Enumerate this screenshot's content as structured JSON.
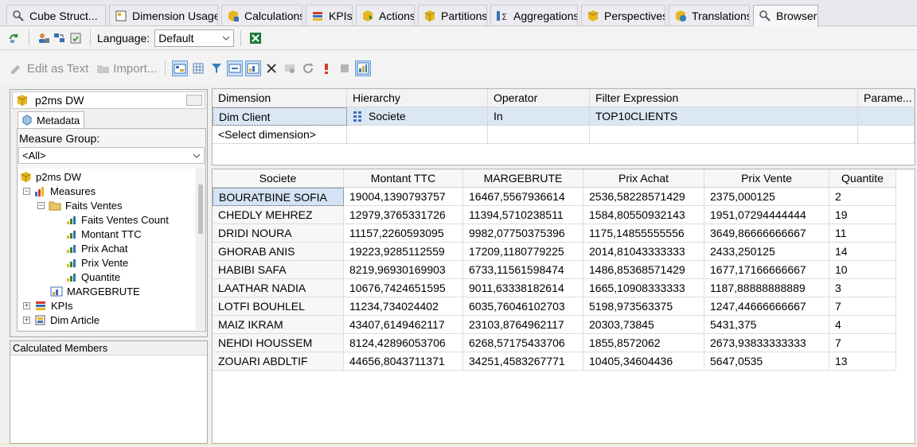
{
  "tabs": [
    {
      "label": "Cube Struct...",
      "icon": "cube-structure-icon"
    },
    {
      "label": "Dimension Usage",
      "icon": "dimension-usage-icon"
    },
    {
      "label": "Calculations",
      "icon": "calculations-icon"
    },
    {
      "label": "KPIs",
      "icon": "kpis-icon"
    },
    {
      "label": "Actions",
      "icon": "actions-icon"
    },
    {
      "label": "Partitions",
      "icon": "partitions-icon"
    },
    {
      "label": "Aggregations",
      "icon": "aggregations-icon"
    },
    {
      "label": "Perspectives",
      "icon": "perspectives-icon"
    },
    {
      "label": "Translations",
      "icon": "translations-icon"
    },
    {
      "label": "Browser",
      "icon": "browser-icon",
      "active": true
    }
  ],
  "toolbar1": {
    "language_label": "Language:",
    "language_value": "Default"
  },
  "toolbar2": {
    "edit_as_text": "Edit as Text",
    "import": "Import..."
  },
  "cube": {
    "name": "p2ms DW",
    "metadata_tab": "Metadata",
    "measure_group_label": "Measure Group:",
    "measure_group_value": "<All>"
  },
  "tree": [
    {
      "label": "p2ms DW",
      "icon": "cube-icon"
    },
    {
      "label": "Measures",
      "icon": "measures-icon",
      "expander": "−"
    },
    {
      "label": "Faits Ventes",
      "icon": "folder-icon",
      "expander": "−"
    },
    {
      "label": "Faits Ventes Count",
      "icon": "measure-icon"
    },
    {
      "label": "Montant TTC",
      "icon": "measure-icon"
    },
    {
      "label": "Prix Achat",
      "icon": "measure-icon"
    },
    {
      "label": "Prix Vente",
      "icon": "measure-icon"
    },
    {
      "label": "Quantite",
      "icon": "measure-icon"
    },
    {
      "label": "MARGEBRUTE",
      "icon": "calculated-measure-icon"
    },
    {
      "label": "KPIs",
      "icon": "kpis-icon",
      "expander": "+"
    },
    {
      "label": "Dim Article",
      "icon": "dimension-icon",
      "expander": "+"
    }
  ],
  "calculated_members_label": "Calculated Members",
  "filter": {
    "headers": [
      "Dimension",
      "Hierarchy",
      "Operator",
      "Filter Expression",
      "Parame..."
    ],
    "rows": [
      [
        "Dim Client",
        "Societe",
        "In",
        "TOP10CLIENTS",
        ""
      ],
      [
        "<Select dimension>",
        "",
        "",
        "",
        ""
      ]
    ]
  },
  "results": {
    "headers": [
      "Societe",
      "Montant TTC",
      "MARGEBRUTE",
      "Prix Achat",
      "Prix Vente",
      "Quantite"
    ],
    "rows": [
      [
        "BOURATBINE SOFIA",
        "19004,1390793757",
        "16467,5567936614",
        "2536,58228571429",
        "2375,000125",
        "2"
      ],
      [
        "CHEDLY MEHREZ",
        "12979,3765331726",
        "11394,5710238511",
        "1584,80550932143",
        "1951,07294444444",
        "19"
      ],
      [
        "DRIDI NOURA",
        "11157,2260593095",
        "9982,07750375396",
        "1175,14855555556",
        "3649,86666666667",
        "11"
      ],
      [
        "GHORAB ANIS",
        "19223,9285112559",
        "17209,1180779225",
        "2014,81043333333",
        "2433,250125",
        "14"
      ],
      [
        "HABIBI SAFA",
        "8219,96930169903",
        "6733,11561598474",
        "1486,85368571429",
        "1677,17166666667",
        "10"
      ],
      [
        "LAATHAR NADIA",
        "10676,7424651595",
        "9011,63338182614",
        "1665,10908333333",
        "1187,88888888889",
        "3"
      ],
      [
        "LOTFI BOUHLEL",
        "11234,734024402",
        "6035,76046102703",
        "5198,973563375",
        "1247,44666666667",
        "7"
      ],
      [
        "MAIZ IKRAM",
        "43407,6149462117",
        "23103,8764962117",
        "20303,73845",
        "5431,375",
        "4"
      ],
      [
        "NEHDI HOUSSEM",
        "8124,42896053706",
        "6268,57175433706",
        "1855,8572062",
        "2673,93833333333",
        "7"
      ],
      [
        "ZOUARI ABDLTIF",
        "44656,8043711371",
        "34251,4583267771",
        "10405,34604436",
        "5647,0535",
        "13"
      ]
    ]
  }
}
